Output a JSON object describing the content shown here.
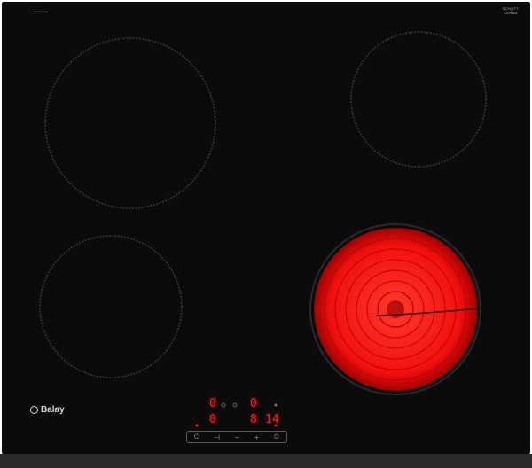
{
  "appliance": {
    "brand": "Balay",
    "glass_brand_line1": "SCHOTT",
    "glass_brand_line2": "CERAN",
    "colors": {
      "glass": "#0b0b0b",
      "heat": "#ff1a1a",
      "ring": "#3a3a3a"
    }
  },
  "zones": [
    {
      "id": "rear-left",
      "active": false
    },
    {
      "id": "rear-right",
      "active": false
    },
    {
      "id": "front-left",
      "active": false
    },
    {
      "id": "front-right",
      "active": true
    }
  ],
  "display": {
    "rear_left_level": "0",
    "rear_right_level": "0",
    "front_left_level": "0",
    "front_right_level": "8",
    "timer": "14"
  },
  "controls": {
    "power_symbol": "⏻",
    "select_symbol": "⊣",
    "minus_symbol": "−",
    "plus_symbol": "+",
    "timer_symbol": "⏲"
  }
}
